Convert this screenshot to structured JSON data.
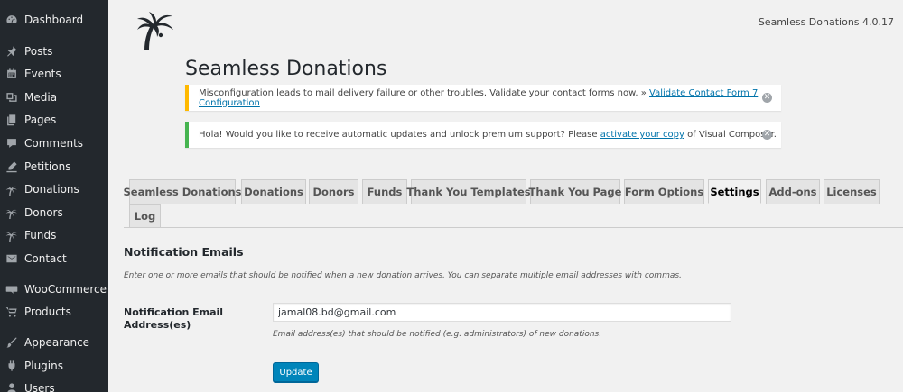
{
  "sidebar": {
    "items": [
      {
        "label": "Dashboard",
        "icon": "dashboard-icon"
      },
      {
        "label": "Posts",
        "icon": "pin-icon"
      },
      {
        "label": "Events",
        "icon": "calendar-icon"
      },
      {
        "label": "Media",
        "icon": "media-icon"
      },
      {
        "label": "Pages",
        "icon": "pages-icon"
      },
      {
        "label": "Comments",
        "icon": "comments-icon"
      },
      {
        "label": "Petitions",
        "icon": "edit-icon"
      },
      {
        "label": "Donations",
        "icon": "palm-icon"
      },
      {
        "label": "Donors",
        "icon": "palm-icon"
      },
      {
        "label": "Funds",
        "icon": "palm-icon"
      },
      {
        "label": "Contact",
        "icon": "envelope-icon"
      },
      {
        "label": "WooCommerce",
        "icon": "woo-icon"
      },
      {
        "label": "Products",
        "icon": "cart-icon"
      },
      {
        "label": "Appearance",
        "icon": "brush-icon"
      },
      {
        "label": "Plugins",
        "icon": "plugin-icon"
      },
      {
        "label": "Users",
        "icon": "user-icon"
      }
    ]
  },
  "header": {
    "version": "Seamless Donations 4.0.17",
    "title": "Seamless Donations"
  },
  "notices": {
    "warning": {
      "text": "Misconfiguration leads to mail delivery failure or other troubles. Validate your contact forms now. »",
      "link": "Validate Contact Form 7 Configuration"
    },
    "success": {
      "text_before": "Hola! Would you like to receive automatic updates and unlock premium support? Please",
      "link": "activate your copy",
      "text_after": "of Visual Composer."
    }
  },
  "tabs": [
    {
      "label": "Seamless Donations"
    },
    {
      "label": "Donations"
    },
    {
      "label": "Donors"
    },
    {
      "label": "Funds"
    },
    {
      "label": "Thank You Templates"
    },
    {
      "label": "Thank You Page"
    },
    {
      "label": "Form Options"
    },
    {
      "label": "Settings"
    },
    {
      "label": "Add-ons"
    },
    {
      "label": "Licenses"
    },
    {
      "label": "Log"
    }
  ],
  "active_tab": "Settings",
  "settings": {
    "section_title": "Notification Emails",
    "section_description": "Enter one or more emails that should be notified when a new donation arrives. You can separate multiple email addresses with commas.",
    "field_label": "Notification Email Address(es)",
    "field_value": "jamal08.bd@gmail.com",
    "field_help": "Email address(es) that should be notified (e.g. administrators) of new donations.",
    "update_label": "Update"
  },
  "colors": {
    "sidebar_bg": "#23282d",
    "warning_border": "#ffb900",
    "success_border": "#46b450",
    "link": "#0073aa",
    "primary_button": "#0085ba"
  }
}
